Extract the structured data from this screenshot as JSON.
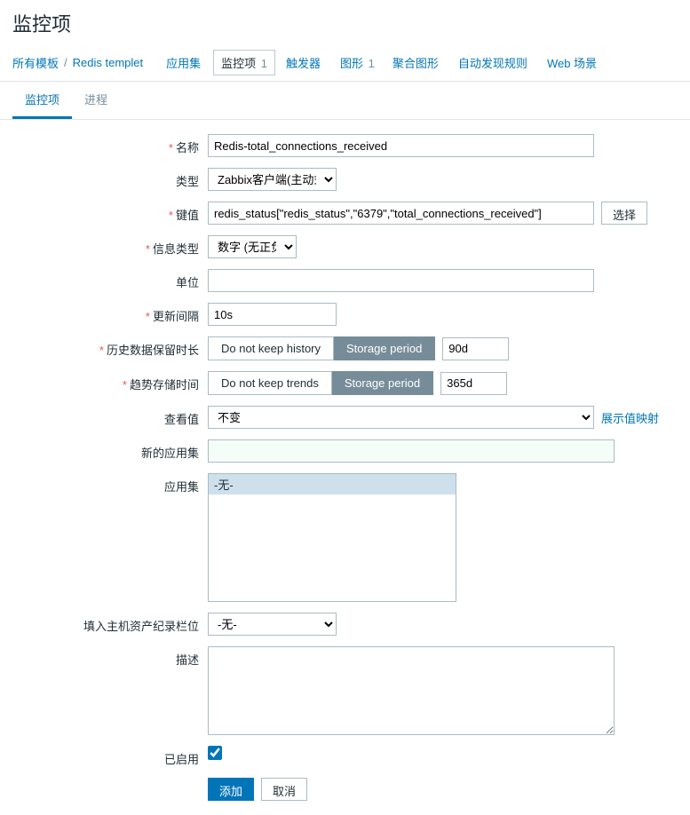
{
  "page": {
    "title": "监控项"
  },
  "breadcrumb": {
    "all_templates": "所有模板",
    "separator": "/",
    "template_name": "Redis templet",
    "items": [
      {
        "label": "应用集",
        "count": ""
      },
      {
        "label": "监控项",
        "count": "1",
        "active": true
      },
      {
        "label": "触发器",
        "count": ""
      },
      {
        "label": "图形",
        "count": "1"
      },
      {
        "label": "聚合图形",
        "count": ""
      },
      {
        "label": "自动发现规则",
        "count": ""
      },
      {
        "label": "Web 场景",
        "count": ""
      }
    ]
  },
  "sub_tabs": [
    {
      "label": "监控项",
      "active": true
    },
    {
      "label": "进程",
      "active": false
    }
  ],
  "form": {
    "name": {
      "label": "名称",
      "value": "Redis-total_connections_received",
      "required": true
    },
    "type": {
      "label": "类型",
      "value": "Zabbix客户端(主动式)",
      "required": true
    },
    "key": {
      "label": "键值",
      "value": "redis_status[\"redis_status\",\"6379\",\"total_connections_received\"]",
      "required": true,
      "select_btn": "选择"
    },
    "info_type": {
      "label": "信息类型",
      "value": "数字 (无正负)",
      "required": true
    },
    "units": {
      "label": "单位",
      "value": ""
    },
    "update_interval": {
      "label": "更新间隔",
      "value": "10s",
      "required": true
    },
    "history": {
      "label": "历史数据保留时长",
      "required": true,
      "seg_no": "Do not keep history",
      "seg_period": "Storage period",
      "value": "90d"
    },
    "trends": {
      "label": "趋势存储时间",
      "required": true,
      "seg_no": "Do not keep trends",
      "seg_period": "Storage period",
      "value": "365d"
    },
    "show_value": {
      "label": "查看值",
      "value": "不变",
      "link": "展示值映射"
    },
    "new_application": {
      "label": "新的应用集",
      "value": ""
    },
    "applications": {
      "label": "应用集",
      "none_option": "-无-"
    },
    "host_inventory": {
      "label": "填入主机资产纪录栏位",
      "value": "-无-"
    },
    "description": {
      "label": "描述",
      "value": ""
    },
    "enabled": {
      "label": "已启用",
      "checked": true
    },
    "actions": {
      "add": "添加",
      "cancel": "取消"
    }
  }
}
